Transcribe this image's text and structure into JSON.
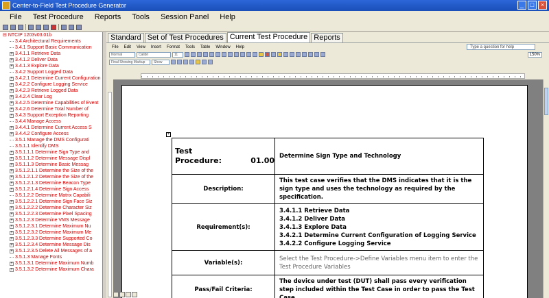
{
  "window": {
    "title": "Center-to-Field Test Procedure Generator"
  },
  "menu": [
    "File",
    "Test Procedure",
    "Reports",
    "Tools",
    "Session Panel",
    "Help"
  ],
  "tree": {
    "root": "NTCIP 1203v03.01b",
    "items": [
      {
        "label": "3.4 Architectural Requirements",
        "exp": false
      },
      {
        "label": "3.4.1 Support Basic Communication",
        "exp": false
      },
      {
        "label": "3.4.1.1 Retrieve Data",
        "exp": true
      },
      {
        "label": "3.4.1.2 Deliver Data",
        "exp": true
      },
      {
        "label": "3.4.1.3 Explore Data",
        "exp": true
      },
      {
        "label": "3.4.2 Support Logged Data",
        "exp": false
      },
      {
        "label": "3.4.2.1 Determine Current Configuration",
        "exp": true
      },
      {
        "label": "3.4.2.2 Configure Logging Service",
        "exp": true
      },
      {
        "label": "3.4.2.3 Retrieve Logged Data",
        "exp": true
      },
      {
        "label": "3.4.2.4 Clear Log",
        "exp": true
      },
      {
        "label": "3.4.2.5 Determine Capabilities of Event",
        "exp": true
      },
      {
        "label": "3.4.2.6 Determine Total Number of",
        "exp": true
      },
      {
        "label": "3.4.3 Support Exception Reporting",
        "exp": true
      },
      {
        "label": "3.4.4 Manage Access",
        "exp": false
      },
      {
        "label": "3.4.4.1 Determine Current Access S",
        "exp": true
      },
      {
        "label": "3.4.4.2 Configure Access",
        "exp": true
      },
      {
        "label": "3.5.1 Manage the DMS Configurati",
        "exp": false
      },
      {
        "label": "3.5.1.1 Identify DMS",
        "exp": false
      },
      {
        "label": "3.5.1.1.1 Determine Sign Type and",
        "exp": true
      },
      {
        "label": "3.5.1.1.2 Determine Message Displ",
        "exp": true
      },
      {
        "label": "3.5.1.1.3 Determine Basic Messag",
        "exp": true
      },
      {
        "label": "3.5.1.2.1.1 Determine the Size of the",
        "exp": true
      },
      {
        "label": "3.5.1.2.1.2 Determine the Size of the",
        "exp": true
      },
      {
        "label": "3.5.1.2.1.3 Determine Beacon Type",
        "exp": true
      },
      {
        "label": "3.5.1.2.1.4 Determine Sign Access",
        "exp": true
      },
      {
        "label": "3.5.1.2.2 Determine Matrix Capabili",
        "exp": false
      },
      {
        "label": "3.5.1.2.2.1 Determine Sign Face Siz",
        "exp": true
      },
      {
        "label": "3.5.1.2.2.2 Determine Character Siz",
        "exp": true
      },
      {
        "label": "3.5.1.2.2.3 Determine Pixel Spacing",
        "exp": true
      },
      {
        "label": "3.5.1.2.3 Determine VMS Message",
        "exp": true
      },
      {
        "label": "3.5.1.2.3.1 Determine Maximum Nu",
        "exp": true
      },
      {
        "label": "3.5.1.2.3.2 Determine Maximum Me",
        "exp": true
      },
      {
        "label": "3.5.1.2.3.3 Determine Supported Co",
        "exp": true
      },
      {
        "label": "3.5.1.2.3.4 Determine Message Dis",
        "exp": true
      },
      {
        "label": "3.5.1.2.3.5 Delete All Messages of a",
        "exp": true
      },
      {
        "label": "3.5.1.3 Manage Fonts",
        "exp": false
      },
      {
        "label": "3.5.1.3.1 Determine Maximum Numb",
        "exp": true
      },
      {
        "label": "3.5.1.3.2 Determine Maximum Chara",
        "exp": true
      }
    ]
  },
  "tabs": [
    "Standard",
    "Set of Test Procedures",
    "Current Test Procedure",
    "Reports"
  ],
  "word": {
    "menu": [
      "File",
      "Edit",
      "View",
      "Insert",
      "Format",
      "Tools",
      "Table",
      "Window",
      "Help"
    ],
    "ask_placeholder": "Type a question for help",
    "style_box": "Normal",
    "font_box": "Calibri",
    "size_box": "11",
    "zoom": "150%",
    "markup_box": "Final Showing Markup",
    "show_button": "Show"
  },
  "procedure": {
    "test_procedure_label": "Test Procedure:",
    "test_procedure_number": "01.00",
    "title": "Determine Sign Type and Technology",
    "description_label": "Description:",
    "description": "This test case verifies that the DMS indicates that it is the sign type and uses the technology as required by the specification.",
    "requirements_label": "Requirement(s):",
    "requirements": [
      "3.4.1.1 Retrieve Data",
      "3.4.1.2 Deliver Data",
      "3.4.1.3 Explore Data",
      "3.4.2.1 Determine Current Configuration of Logging Service",
      "3.4.2.2 Configure Logging Service"
    ],
    "variables_label": "Variable(s):",
    "variables": "Select the Test Procedure->Define Variables menu item to enter the Test Procedure Variables",
    "passfail_label": "Pass/Fail Criteria:",
    "passfail": "The device under test (DUT) shall pass every verification step included within the Test Case in order to pass the Test Case."
  }
}
